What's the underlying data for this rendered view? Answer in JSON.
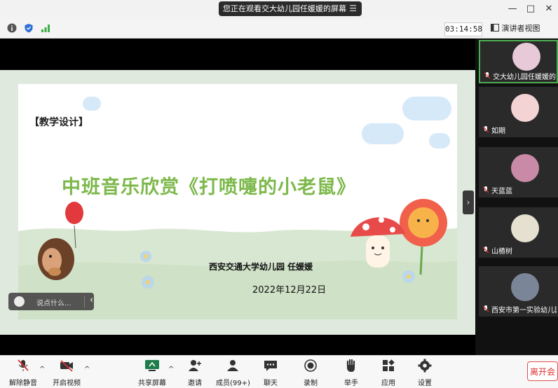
{
  "window": {
    "share_banner": "您正在观看交大幼儿园任媛媛的屏幕",
    "minimize": "—",
    "maximize": "□",
    "close": "✕"
  },
  "infobar": {
    "timer": "03:14:58",
    "view_mode": "演讲者视图"
  },
  "slide": {
    "tag": "【教学设计】",
    "title": "中班音乐欣赏《打喷嚏的小老鼠》",
    "school": "西安交通大学幼儿园  任媛媛",
    "date": "2022年12月22日"
  },
  "chat_input": {
    "placeholder": "说点什么..."
  },
  "participants": [
    {
      "name": "交大幼儿园任媛媛的",
      "active": true,
      "avatar_color": "#e8c9d8"
    },
    {
      "name": "如期",
      "active": false,
      "avatar_color": "#f3d3d3"
    },
    {
      "name": "天蓝蓝",
      "active": false,
      "avatar_color": "#c98aa8"
    },
    {
      "name": "山楂树",
      "active": false,
      "avatar_color": "#e5e0d0"
    },
    {
      "name": "西安市第一实验幼儿园",
      "active": false,
      "avatar_color": "#7a8597"
    }
  ],
  "toolbar": {
    "mute": "解除静音",
    "video": "开启视频",
    "share": "共享屏幕",
    "invite": "邀请",
    "members": "成员(99+)",
    "chat": "聊天",
    "record": "录制",
    "raise_hand": "举手",
    "apps": "应用",
    "settings": "设置",
    "leave": "离开会"
  },
  "colors": {
    "accent_green": "#4caf50",
    "title_green": "#7cb84a",
    "leave_red": "#e03030"
  }
}
